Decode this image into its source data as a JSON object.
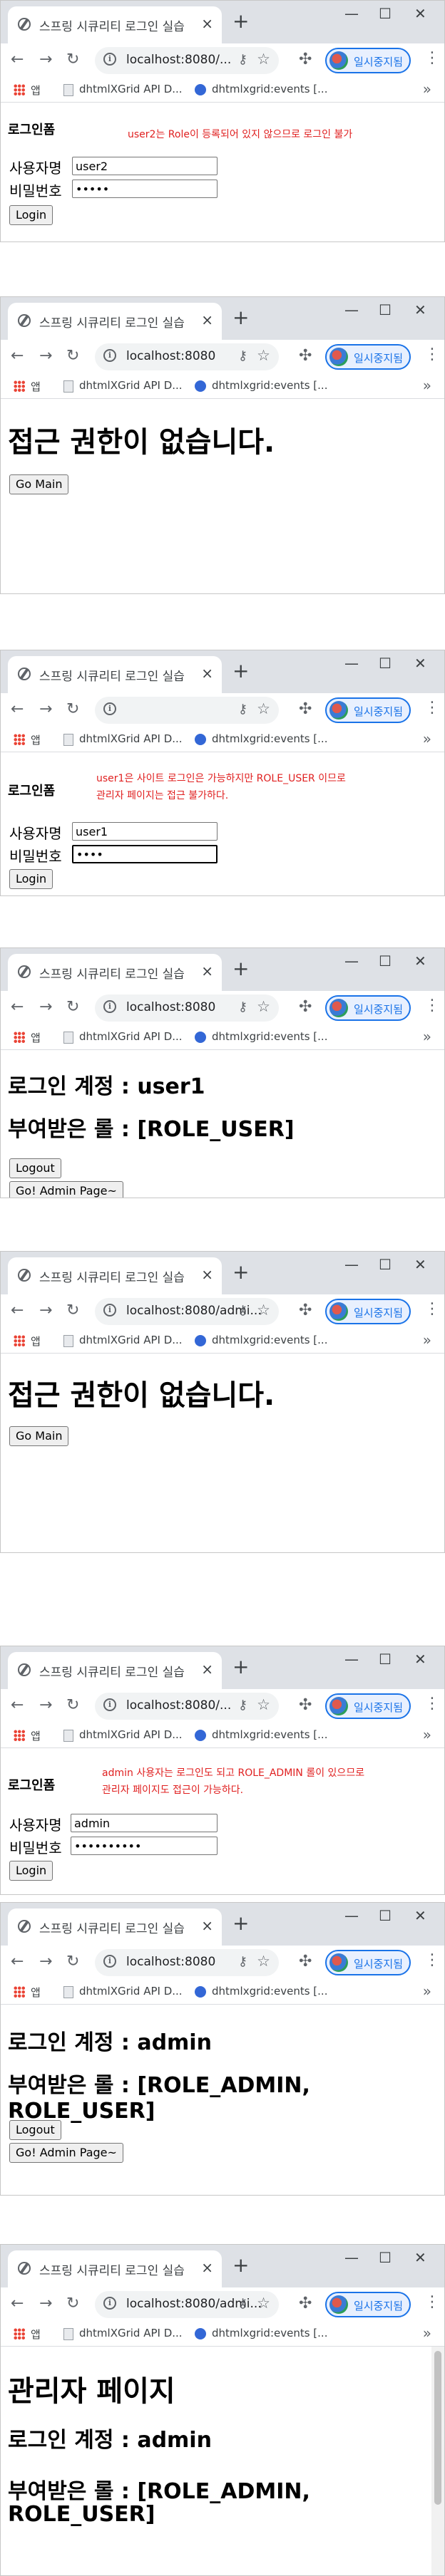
{
  "browser": {
    "tab_title": "스프링 시큐리티 로그인 실습",
    "close_glyph": "×",
    "new_tab_glyph": "+",
    "profile_label": "일시중지됨",
    "bookmarks": {
      "apps": "앱",
      "item1": "dhtmlXGrid API D...",
      "item2": "dhtmlxgrid:events [...",
      "more": "»"
    }
  },
  "screens": [
    {
      "url": "localhost:8080/...",
      "login": {
        "title": "로그인폼",
        "note": "user2는 Role이 등록되어 있지 않으므로 로그인 불가",
        "username_label": "사용자명",
        "username_value": "user2",
        "password_label": "비밀번호",
        "password_value": "•••••",
        "login_button": "Login"
      }
    },
    {
      "url": "localhost:8080",
      "denied": {
        "heading": "접근 권한이 없습니다.",
        "button": "Go Main"
      }
    },
    {
      "url": "",
      "login": {
        "title": "로그인폼",
        "note_line1": "user1은 사이트 로그인은 가능하지만 ROLE_USER 이므로",
        "note_line2": "관리자 페이지는 접근 불가하다.",
        "username_label": "사용자명",
        "username_value": "user1",
        "password_label": "비밀번호",
        "password_value": "••••",
        "login_button": "Login"
      }
    },
    {
      "url": "localhost:8080",
      "info": {
        "account": "로그인 계정 : user1",
        "roles": "부여받은 롤 : [ROLE_USER]",
        "logout_button": "Logout",
        "admin_button": "Go! Admin Page~"
      }
    },
    {
      "url": "localhost:8080/admi...",
      "denied": {
        "heading": "접근 권한이 없습니다.",
        "button": "Go Main"
      }
    },
    {
      "url": "localhost:8080/...",
      "login": {
        "title": "로그인폼",
        "note_line1": "admin 사용자는 로그인도 되고 ROLE_ADMIN 롤이 있으므로",
        "note_line2": "관리자 페이지도 접근이 가능하다.",
        "username_label": "사용자명",
        "username_value": "admin",
        "password_label": "비밀번호",
        "password_value": "••••••••••",
        "login_button": "Login"
      }
    },
    {
      "url": "localhost:8080",
      "info": {
        "account": "로그인 계정 : admin",
        "roles": "부여받은 롤 : [ROLE_ADMIN, ROLE_USER]",
        "logout_button": "Logout",
        "admin_button": "Go! Admin Page~"
      }
    },
    {
      "url": "localhost:8080/admi...",
      "admin": {
        "heading": "관리자 페이지",
        "account": "로그인 계정 : admin",
        "roles_line1": "부여받은 롤 : [ROLE_ADMIN,",
        "roles_line2": "ROLE_USER]"
      }
    }
  ],
  "colors": {
    "note_red": "#e02020",
    "profile_blue": "#1a73e8",
    "tab_strip": "#dee1e6"
  }
}
